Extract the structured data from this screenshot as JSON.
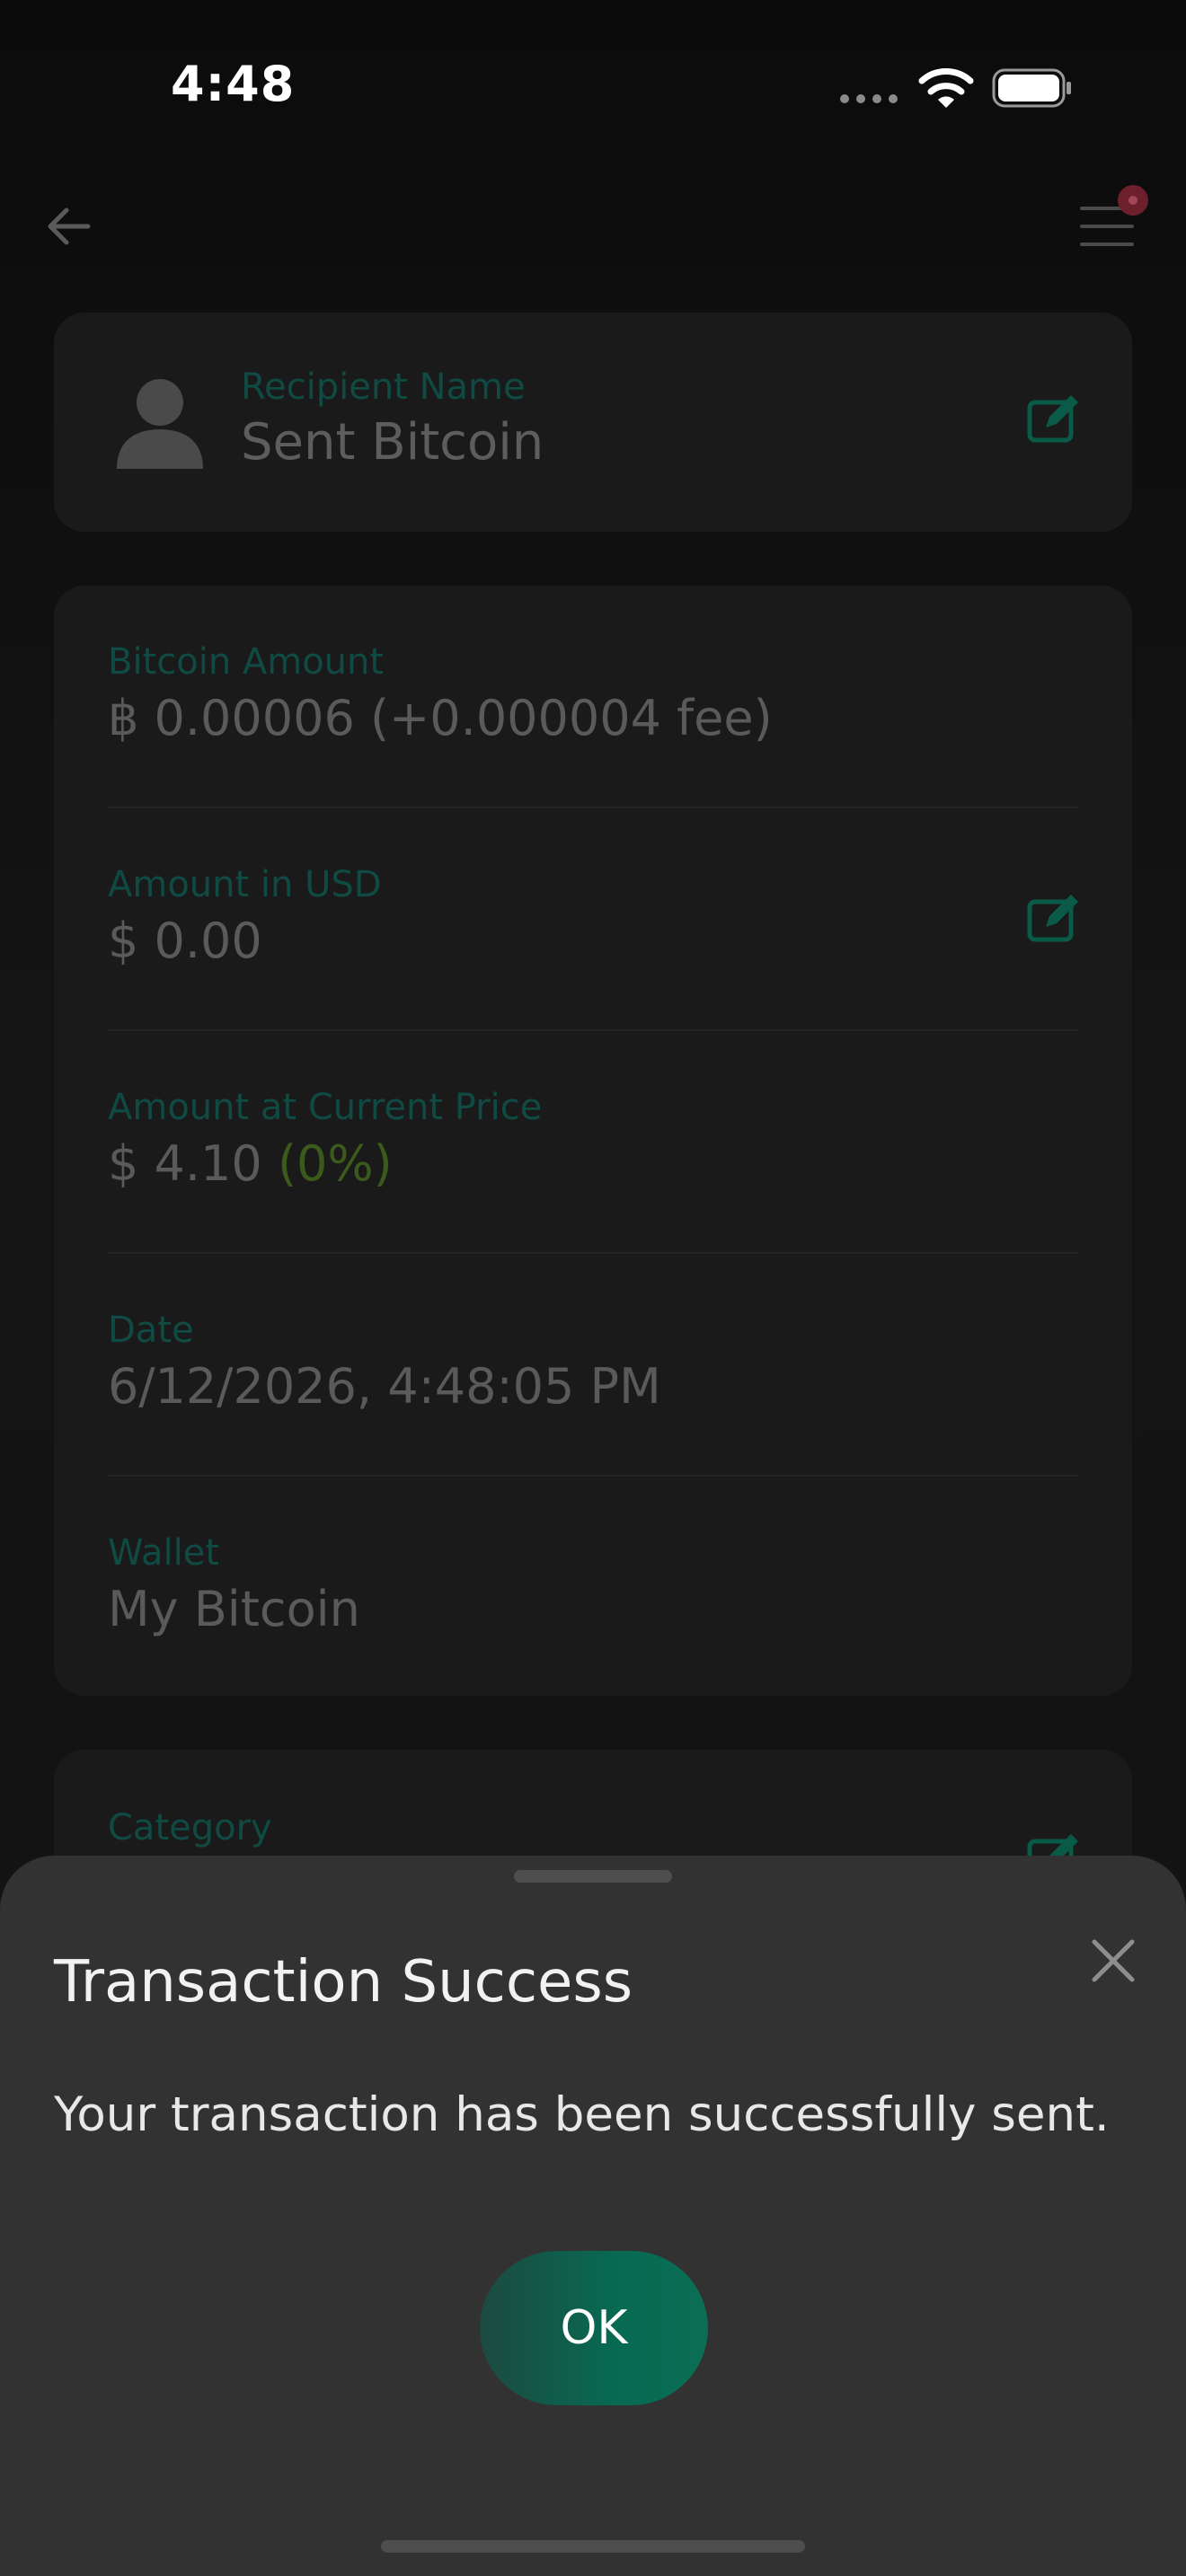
{
  "status_bar": {
    "time": "4:48",
    "icons": [
      "signal-dots-icon",
      "wifi-icon",
      "battery-icon"
    ]
  },
  "nav": {
    "back_icon": "arrow-left-icon",
    "menu_icon": "hamburger-menu-icon",
    "notification_badge_color": "#6e1f2c"
  },
  "recipient": {
    "label": "Recipient Name",
    "value": "Sent Bitcoin",
    "avatar_icon": "person-icon",
    "edit_icon": "edit-icon"
  },
  "details": {
    "bitcoin_amount": {
      "label": "Bitcoin Amount",
      "value": "฿ 0.00006 (+0.000004 fee)"
    },
    "amount_usd": {
      "label": "Amount in USD",
      "value": "$ 0.00"
    },
    "amount_current": {
      "label": "Amount at Current Price",
      "value": "$ 4.10",
      "percent": "(0%)"
    },
    "date": {
      "label": "Date",
      "value": "6/12/2026, 4:48:05 PM"
    },
    "wallet": {
      "label": "Wallet",
      "value": "My Bitcoin"
    }
  },
  "category": {
    "label": "Category"
  },
  "sheet": {
    "title": "Transaction Success",
    "message": "Your transaction has been successfully sent.",
    "ok_label": "OK",
    "close_icon": "close-icon"
  },
  "colors": {
    "accent": "#0a6e55",
    "label_teal": "#0f4a43",
    "percent_green": "#3b5a1c",
    "sheet_bg": "#323232",
    "card_bg": "#1a1a1a"
  }
}
